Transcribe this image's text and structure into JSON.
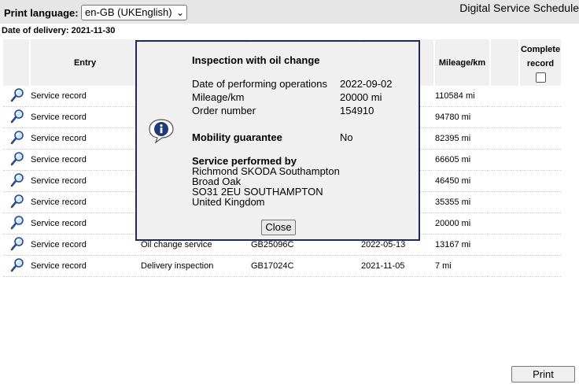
{
  "header": {
    "print_language_label": "Print language:",
    "language_selected": "en-GB (UKEnglish)",
    "app_title": "Digital Service Schedule"
  },
  "delivery": {
    "label": "Date of delivery:",
    "date": "2021-11-30"
  },
  "table": {
    "headers": {
      "entry": "Entry",
      "mileage": "Mileage/km",
      "complete_line1": "Complete",
      "complete_line2": "record"
    },
    "rows": [
      {
        "entry": "Service record",
        "text": "",
        "order": "",
        "date": "",
        "mileage": "110584 mi"
      },
      {
        "entry": "Service record",
        "text": "",
        "order": "",
        "date": "",
        "mileage": "94780 mi"
      },
      {
        "entry": "Service record",
        "text": "",
        "order": "",
        "date": "",
        "mileage": "82395 mi"
      },
      {
        "entry": "Service record",
        "text": "",
        "order": "",
        "date": "",
        "mileage": "66605 mi"
      },
      {
        "entry": "Service record",
        "text": "",
        "order": "",
        "date": "",
        "mileage": "46450 mi"
      },
      {
        "entry": "Service record",
        "text": "",
        "order": "",
        "date": "",
        "mileage": "35355 mi"
      },
      {
        "entry": "Service record",
        "text": "",
        "order": "",
        "date": "",
        "mileage": "20000 mi"
      },
      {
        "entry": "Service record",
        "text": "Oil change service",
        "order": "GB25096C",
        "date": "2022-05-13",
        "mileage": "13167 mi"
      },
      {
        "entry": "Service record",
        "text": "Delivery inspection",
        "order": "GB17024C",
        "date": "2021-11-05",
        "mileage": "7 mi"
      }
    ]
  },
  "dialog": {
    "title": "Inspection with oil change",
    "date_label": "Date of performing operations",
    "date_value": "2022-09-02",
    "mileage_label": "Mileage/km",
    "mileage_value": "20000 mi",
    "order_label": "Order number",
    "order_value": "154910",
    "mobility_label": "Mobility guarantee",
    "mobility_value": "No",
    "performed_by_label": "Service performed by",
    "dealer_name": "Richmond SKODA Southampton",
    "dealer_street": "Broad Oak",
    "dealer_city": "SO31 2EU SOUTHAMPTON",
    "dealer_country": "United Kingdom",
    "close_label": "Close"
  },
  "footer": {
    "print_label": "Print"
  },
  "icons": {
    "row_icon": "magnifier-icon",
    "dialog_icon": "info-icon"
  }
}
